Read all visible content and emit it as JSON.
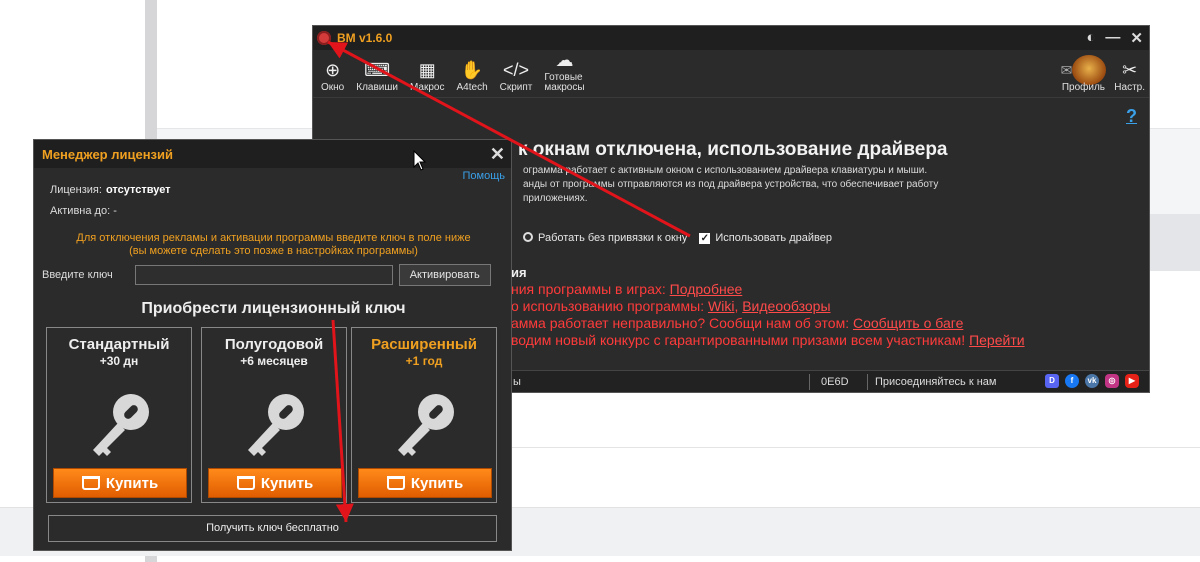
{
  "main_window": {
    "title": "BM v1.6.0",
    "toolbar": [
      {
        "label": "Окно",
        "icon": "crosshair-icon"
      },
      {
        "label": "Клавиши",
        "icon": "keyboard-icon"
      },
      {
        "label": "Макрос",
        "icon": "keys-grid-icon"
      },
      {
        "label": "A4tech",
        "icon": "a4tech-icon"
      },
      {
        "label": "Скрипт",
        "icon": "code-icon"
      },
      {
        "label": "Готовые\nмакросы",
        "icon": "ready-macros-icon"
      }
    ],
    "toolbar_right": [
      {
        "label": "Профиль",
        "icon": "profile-avatar-icon"
      },
      {
        "label": "Настр.",
        "icon": "settings-tools-icon"
      }
    ],
    "help": "?",
    "heading": "к окнам отключена, использование драйвера",
    "desc_lines": [
      "ограмма работает с активным окном с использованием драйвера клавиатуры и мыши.",
      "анды от программы отправляются из под драйвера устройства, что обеспечивает работу",
      "приложениях."
    ],
    "radio_label": "Работать без привязки к окну",
    "checkbox_label": "Использовать драйвер",
    "news_heading": "ия",
    "news": [
      {
        "text": "ния программы в играх: ",
        "link": "Подробнее",
        "extra": ""
      },
      {
        "text": "о использованию программы: ",
        "link": "Wiki",
        "extra": "Видеообзоры"
      },
      {
        "text": "амма работает неправильно? Сообщи нам об этом: ",
        "link": "Сообщить о баге",
        "extra": ""
      },
      {
        "text": "водим новый конкурс с гарантированными призами всем участникам! ",
        "link": "Перейти",
        "extra": ""
      }
    ],
    "status": {
      "left": "ы",
      "code": "0E6D",
      "join": "Присоединяйтесь к нам"
    }
  },
  "license": {
    "title": "Менеджер лицензий",
    "help": "Помощь",
    "license_label": "Лицензия:",
    "license_value": "отсутствует",
    "active_label": "Активна до:",
    "active_value": "-",
    "note1": "Для отключения рекламы и активации программы введите ключ в поле ниже",
    "note2": "(вы можете сделать это позже в настройках программы)",
    "key_label": "Введите ключ",
    "activate": "Активировать",
    "buy_heading": "Приобрести лицензионный ключ",
    "plans": [
      {
        "name": "Стандартный",
        "duration": "+30 дн",
        "buy": "Купить"
      },
      {
        "name": "Полугодовой",
        "duration": "+6 месяцев",
        "buy": "Купить"
      },
      {
        "name": "Расширенный",
        "duration": "+1 год",
        "buy": "Купить"
      }
    ],
    "free": "Получить ключ бесплатно"
  },
  "colors": {
    "accent": "#f0a020",
    "danger": "#ff3b3b",
    "link": "#3aa0e8",
    "window_bg": "#2b2b2b"
  }
}
